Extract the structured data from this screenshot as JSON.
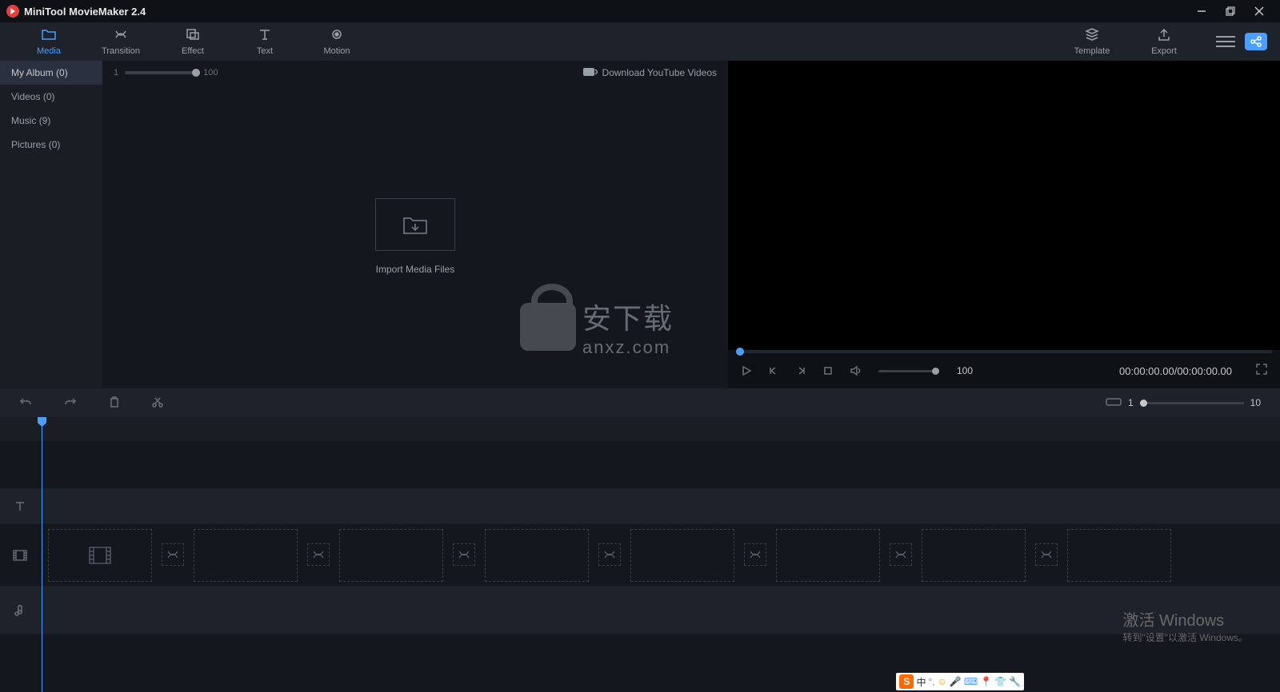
{
  "titlebar": {
    "app_name": "MiniTool MovieMaker 2.4"
  },
  "toolbar": {
    "tabs": [
      {
        "label": "Media",
        "active": true
      },
      {
        "label": "Transition"
      },
      {
        "label": "Effect"
      },
      {
        "label": "Text"
      },
      {
        "label": "Motion"
      }
    ],
    "template_label": "Template",
    "export_label": "Export"
  },
  "sidebar": {
    "items": [
      {
        "label": "My Album",
        "count": "(0)",
        "active": true
      },
      {
        "label": "Videos",
        "count": "(0)"
      },
      {
        "label": "Music",
        "count": "(9)"
      },
      {
        "label": "Pictures",
        "count": "(0)"
      }
    ]
  },
  "media": {
    "slider_min": "1",
    "slider_max": "100",
    "download_label": "Download YouTube Videos",
    "import_label": "Import Media Files"
  },
  "preview": {
    "volume": "100",
    "time": "00:00:00.00/00:00:00.00"
  },
  "timeline": {
    "zoom_min": "1",
    "zoom_max": "10"
  },
  "watermark": {
    "text_cn": "安下载",
    "url": "anxz.com"
  },
  "activate": {
    "title": "激活 Windows",
    "sub": "转到\"设置\"以激活 Windows。"
  },
  "ime": {
    "s": "S",
    "lang": "中"
  }
}
